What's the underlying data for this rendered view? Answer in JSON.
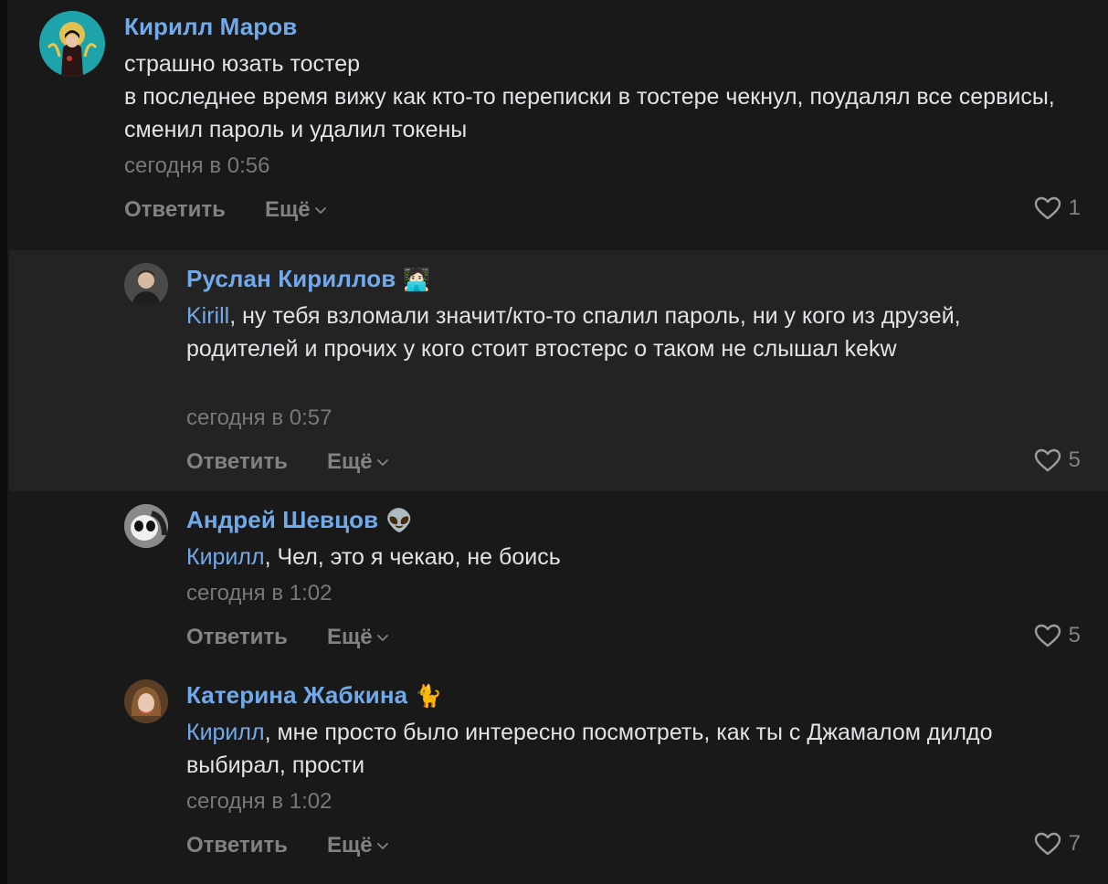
{
  "comments": [
    {
      "author": "Кирилл Маров",
      "author_emoji": "",
      "mention": "",
      "text_lines": [
        "страшно юзать тостер",
        "в последнее время вижу как кто-то переписки в тостере чекнул, поудалял все сервисы, сменил пароль и удалил токены"
      ],
      "time": "сегодня в 0:56",
      "reply_label": "Ответить",
      "more_label": "Ещё",
      "likes": "1"
    },
    {
      "author": "Руслан Кириллов",
      "author_emoji": "🧑🏻‍💻",
      "mention": "Kirill",
      "text": ", ну тебя взломали значит/кто-то спалил пароль, ни у кого из друзей, родителей и прочих у кого стоит втостерс о таком не слышал kekw",
      "time": "сегодня в 0:57",
      "reply_label": "Ответить",
      "more_label": "Ещё",
      "likes": "5"
    },
    {
      "author": "Андрей Шевцов",
      "author_emoji": "👽",
      "mention": "Кирилл",
      "text": ", Чел, это я чекаю, не боись",
      "time": "сегодня в 1:02",
      "reply_label": "Ответить",
      "more_label": "Ещё",
      "likes": "5"
    },
    {
      "author": "Катерина Жабкина",
      "author_emoji": "🐈",
      "mention": "Кирилл",
      "text": ", мне просто было интересно посмотреть, как ты с Джамалом дилдо выбирал, прости",
      "time": "сегодня в 1:02",
      "reply_label": "Ответить",
      "more_label": "Ещё",
      "likes": "7"
    }
  ],
  "colors": {
    "background": "#19191a",
    "highlight": "#232324",
    "link": "#71aaeb",
    "text": "#e1e3e6",
    "muted": "#828282"
  },
  "icons": [
    "heart-icon",
    "chevron-down-icon"
  ]
}
